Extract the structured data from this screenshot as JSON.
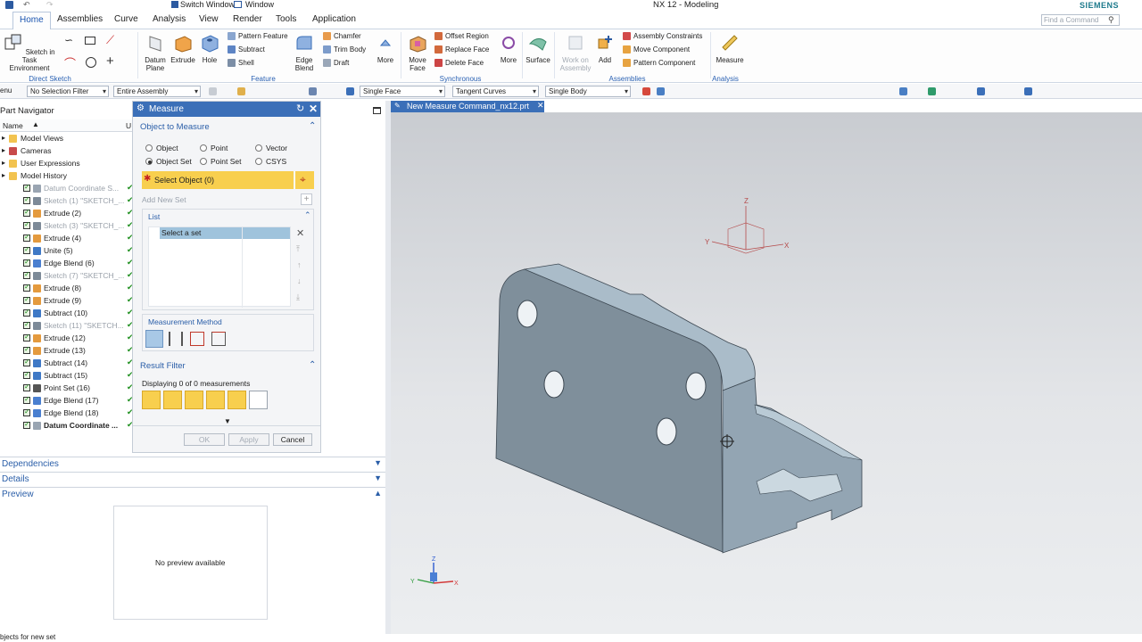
{
  "app": {
    "title": "NX 12 - Modeling",
    "brand": "SIEMENS",
    "qa_switch": "Switch Window",
    "qa_window": "Window",
    "search_placeholder": "Find a Command"
  },
  "menu": [
    "Home",
    "Assemblies",
    "Curve",
    "Analysis",
    "View",
    "Render",
    "Tools",
    "Application"
  ],
  "ribbon": {
    "sketch": "Sketch in Task Environment",
    "direct_sketch": "Direct Sketch",
    "datum_plane": "Datum Plane",
    "extrude": "Extrude",
    "hole": "Hole",
    "pattern_feature": "Pattern Feature",
    "subtract": "Subtract",
    "shell": "Shell",
    "edge_blend": "Edge Blend",
    "chamfer": "Chamfer",
    "trim_body": "Trim Body",
    "draft": "Draft",
    "more1": "More",
    "feature": "Feature",
    "move_face": "Move Face",
    "offset_region": "Offset Region",
    "replace_face": "Replace Face",
    "delete_face": "Delete Face",
    "more2": "More",
    "sync": "Synchronous Modeling",
    "surface": "Surface",
    "work_on_assembly": "Work on Assembly",
    "add": "Add",
    "assembly_constraints": "Assembly Constraints",
    "move_component": "Move Component",
    "pattern_component": "Pattern Component",
    "assemblies": "Assemblies",
    "measure": "Measure",
    "analysis": "Analysis"
  },
  "selbar": {
    "menu": "enu",
    "filter": "No Selection Filter",
    "scope": "Entire Assembly",
    "face": "Single Face",
    "curves": "Tangent Curves",
    "body": "Single Body"
  },
  "navigator": {
    "title": "Part Navigator",
    "col_name": "Name",
    "col_u": "U",
    "items": [
      {
        "label": "Model Views",
        "lvl": 0,
        "kind": "folder",
        "dim": false,
        "check": false
      },
      {
        "label": "Cameras",
        "lvl": 0,
        "kind": "camera",
        "dim": false,
        "check": false
      },
      {
        "label": "User Expressions",
        "lvl": 0,
        "kind": "folder",
        "dim": false,
        "check": false
      },
      {
        "label": "Model History",
        "lvl": 0,
        "kind": "folder",
        "dim": false,
        "check": false
      },
      {
        "label": "Datum Coordinate S...",
        "lvl": 1,
        "kind": "datum",
        "dim": true,
        "check": true
      },
      {
        "label": "Sketch (1) \"SKETCH_...",
        "lvl": 1,
        "kind": "sketch",
        "dim": true,
        "check": true
      },
      {
        "label": "Extrude (2)",
        "lvl": 1,
        "kind": "extrude",
        "dim": false,
        "check": true
      },
      {
        "label": "Sketch (3) \"SKETCH_...",
        "lvl": 1,
        "kind": "sketch",
        "dim": true,
        "check": true
      },
      {
        "label": "Extrude (4)",
        "lvl": 1,
        "kind": "extrude",
        "dim": false,
        "check": true
      },
      {
        "label": "Unite (5)",
        "lvl": 1,
        "kind": "bool",
        "dim": false,
        "check": true
      },
      {
        "label": "Edge Blend (6)",
        "lvl": 1,
        "kind": "blend",
        "dim": false,
        "check": true
      },
      {
        "label": "Sketch (7) \"SKETCH_...",
        "lvl": 1,
        "kind": "sketch",
        "dim": true,
        "check": true
      },
      {
        "label": "Extrude (8)",
        "lvl": 1,
        "kind": "extrude",
        "dim": false,
        "check": true
      },
      {
        "label": "Extrude (9)",
        "lvl": 1,
        "kind": "extrude",
        "dim": false,
        "check": true
      },
      {
        "label": "Subtract (10)",
        "lvl": 1,
        "kind": "bool",
        "dim": false,
        "check": true
      },
      {
        "label": "Sketch (11) \"SKETCH...",
        "lvl": 1,
        "kind": "sketch",
        "dim": true,
        "check": true
      },
      {
        "label": "Extrude (12)",
        "lvl": 1,
        "kind": "extrude",
        "dim": false,
        "check": true
      },
      {
        "label": "Extrude (13)",
        "lvl": 1,
        "kind": "extrude",
        "dim": false,
        "check": true
      },
      {
        "label": "Subtract (14)",
        "lvl": 1,
        "kind": "bool",
        "dim": false,
        "check": true
      },
      {
        "label": "Subtract (15)",
        "lvl": 1,
        "kind": "bool",
        "dim": false,
        "check": true
      },
      {
        "label": "Point Set (16)",
        "lvl": 1,
        "kind": "point",
        "dim": false,
        "check": true
      },
      {
        "label": "Edge Blend (17)",
        "lvl": 1,
        "kind": "blend",
        "dim": false,
        "check": true
      },
      {
        "label": "Edge Blend (18)",
        "lvl": 1,
        "kind": "blend",
        "dim": false,
        "check": true
      },
      {
        "label": "Datum Coordinate ...",
        "lvl": 1,
        "kind": "datum",
        "dim": false,
        "check": true,
        "bold": true
      }
    ]
  },
  "panels": {
    "dependencies": "Dependencies",
    "details": "Details",
    "preview": "Preview",
    "no_preview": "No preview available"
  },
  "dialog": {
    "title": "Measure",
    "section1": "Object to Measure",
    "opt_object": "Object",
    "opt_point": "Point",
    "opt_vector": "Vector",
    "opt_object_set": "Object Set",
    "opt_point_set": "Point Set",
    "opt_csys": "CSYS",
    "select_object": "Select Object (0)",
    "add_new_set": "Add New Set",
    "list": "List",
    "select_a_set": "Select a set",
    "method": "Measurement Method",
    "section2": "Result Filter",
    "displaying": "Displaying 0 of 0 measurements",
    "ok": "OK",
    "apply": "Apply",
    "cancel": "Cancel"
  },
  "viewport": {
    "tab": "New Measure Command_nx12.prt",
    "axis_x": "X",
    "axis_y": "Y",
    "axis_z": "Z"
  },
  "status": "bjects for new set",
  "colors": {
    "accent": "#3b6fb8",
    "select_yellow": "#f8cf4e",
    "part": "#7f8f9b"
  }
}
